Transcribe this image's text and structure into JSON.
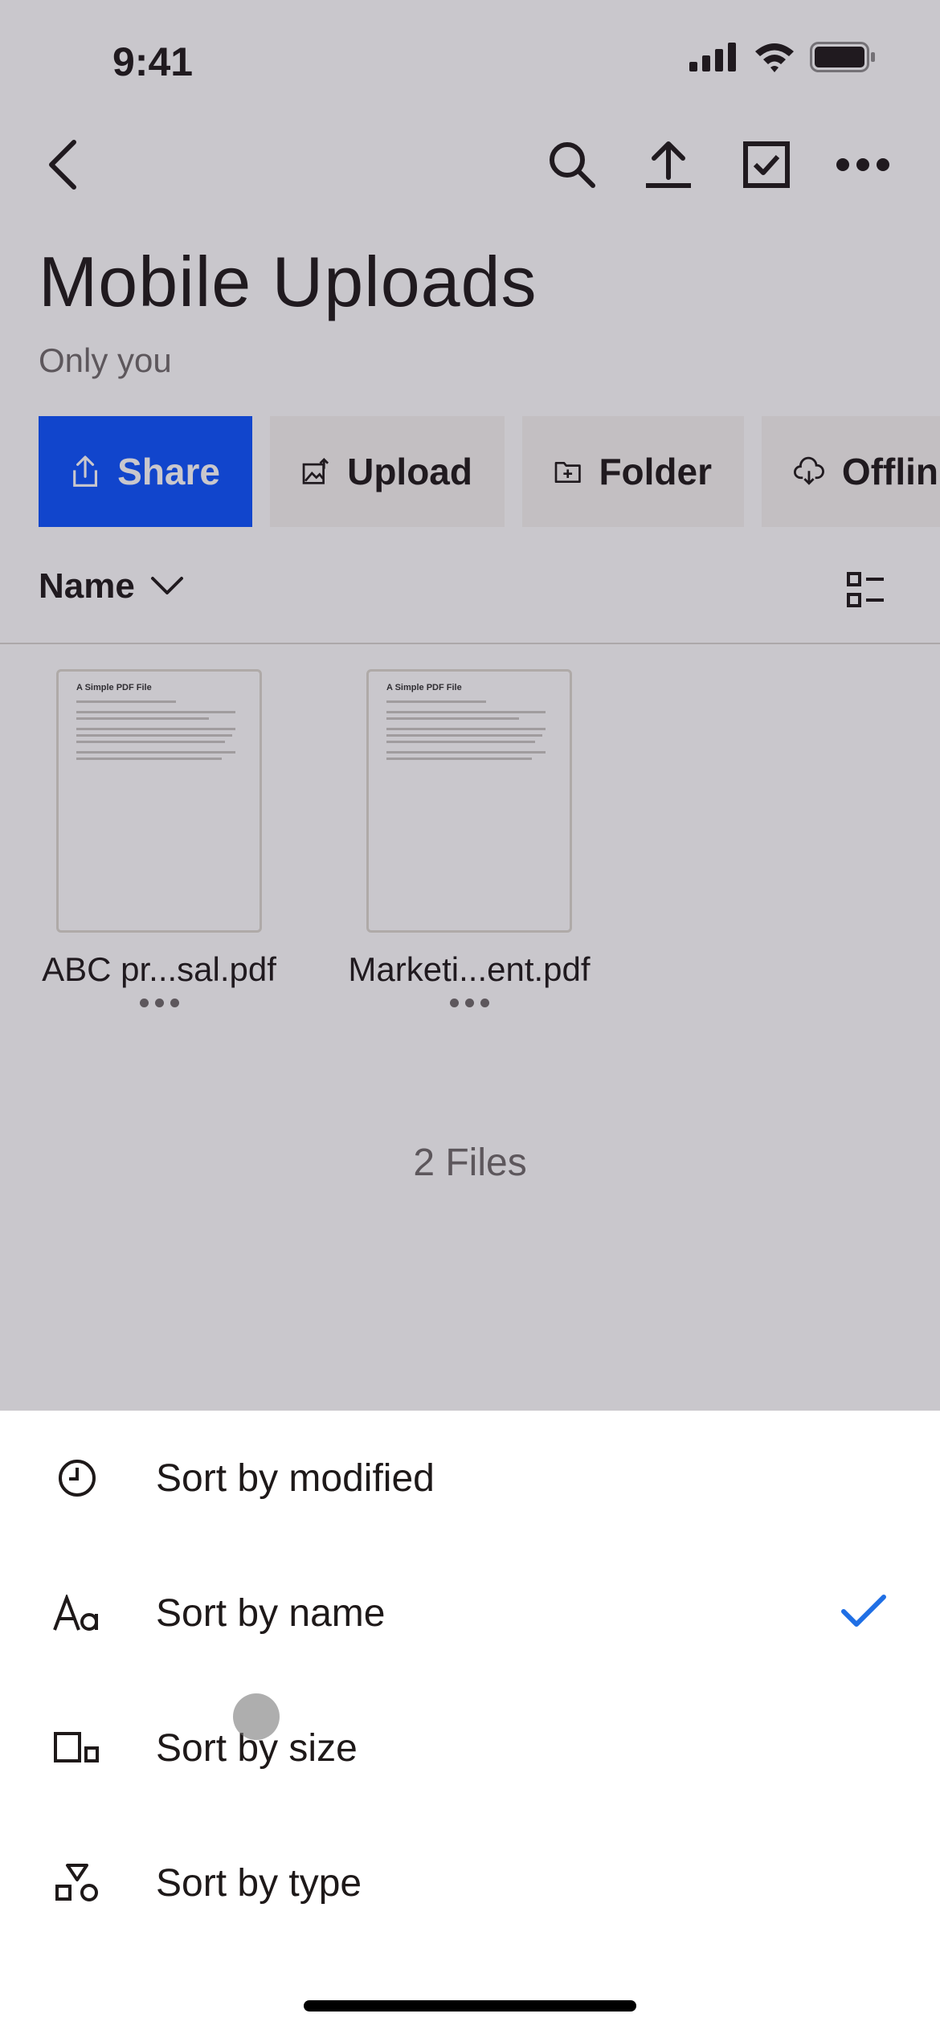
{
  "status": {
    "time": "9:41"
  },
  "header": {
    "title": "Mobile Uploads",
    "subtitle": "Only you"
  },
  "actions": [
    {
      "label": "Share",
      "icon": "share-icon"
    },
    {
      "label": "Upload",
      "icon": "upload-photo-icon"
    },
    {
      "label": "Folder",
      "icon": "folder-plus-icon"
    },
    {
      "label": "Offlin",
      "icon": "cloud-download-icon"
    }
  ],
  "sort": {
    "label": "Name"
  },
  "files": [
    {
      "name": "ABC pr...sal.pdf",
      "preview_title": "A Simple PDF File"
    },
    {
      "name": "Marketi...ent.pdf",
      "preview_title": "A Simple PDF File"
    }
  ],
  "file_count": "2 Files",
  "sheet": {
    "options": [
      {
        "label": "Sort by modified",
        "icon": "clock-icon",
        "selected": false
      },
      {
        "label": "Sort by name",
        "icon": "text-case-icon",
        "selected": true
      },
      {
        "label": "Sort by size",
        "icon": "size-icon",
        "selected": false
      },
      {
        "label": "Sort by type",
        "icon": "shapes-icon",
        "selected": false
      }
    ]
  },
  "colors": {
    "accent": "#0a52ff",
    "check": "#1f6fe5"
  }
}
